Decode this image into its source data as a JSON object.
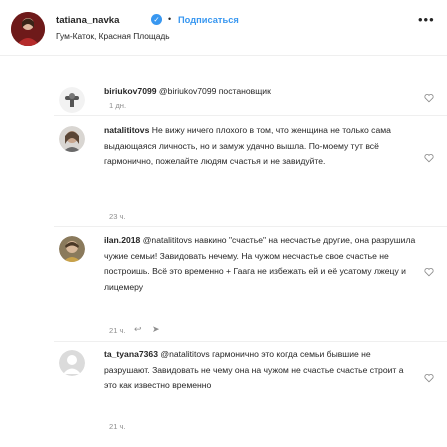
{
  "post": {
    "username": "tatiana_navka",
    "verified_glyph": "✓",
    "dot": "•",
    "follow_label": "Подписаться",
    "location": "Гум-Каток, Красная Площадь",
    "more_icon": "more-icon"
  },
  "comments": [
    {
      "username": "biriukov7099",
      "text": " @biriukov7099 постановщик",
      "time": "1 дн.",
      "avatar": "avatar-icon"
    },
    {
      "username": "natalititovs",
      "text": " Не вижу ничего плохого в том, что женщина не только сама выдающаяся личность, но и замуж удачно вышла. По-моему тут всё гармонично, пожелайте людям счастья и не завидуйте.",
      "time": "23 ч."
    },
    {
      "username": "ilan.2018",
      "text": " @natalititovs навкино \"счастье\" на несчастье другие, она разрушила чужие семьи! Завидовать нечему. На чужом несчастье свое счастье не построишь. Всё это временно + Гаага не избежать ей и её усатому лжецу и лицемеру",
      "time": "21 ч."
    },
    {
      "username": "ta_tyana7363",
      "text": " @natalititovs гармонично это когда семьи бывшие не разрушают. Завидовать не чему она на чужом не счастье счастье строит а это как известно временно",
      "time": "21 ч."
    }
  ],
  "colors": {
    "link": "#3897f0",
    "text": "#262626",
    "muted": "#8e8e8e",
    "divider": "#efefef"
  }
}
